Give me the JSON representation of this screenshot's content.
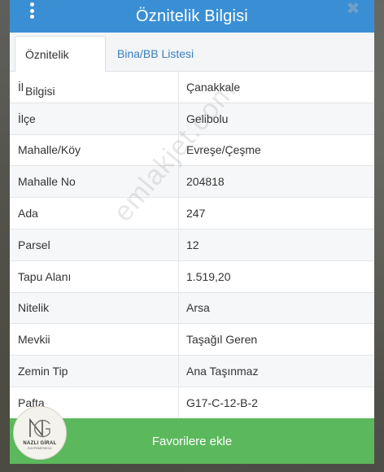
{
  "dialog": {
    "title": "Öznitelik Bilgisi",
    "close_symbol": "✖"
  },
  "tabs": [
    {
      "label": "Öznitelik Bilgisi",
      "active": true
    },
    {
      "label": "Bina/BB Listesi",
      "active": false
    }
  ],
  "rows": [
    {
      "label": "İl",
      "value": "Çanakkale"
    },
    {
      "label": "İlçe",
      "value": "Gelibolu"
    },
    {
      "label": "Mahalle/Köy",
      "value": "Evreşe/Çeşme"
    },
    {
      "label": "Mahalle No",
      "value": "204818"
    },
    {
      "label": "Ada",
      "value": "247"
    },
    {
      "label": "Parsel",
      "value": "12"
    },
    {
      "label": "Tapu Alanı",
      "value": "1.519,20"
    },
    {
      "label": "Nitelik",
      "value": "Arsa"
    },
    {
      "label": "Mevkii",
      "value": "Taşağıl Geren"
    },
    {
      "label": "Zemin Tip",
      "value": "Ana Taşınmaz"
    },
    {
      "label": "Pafta",
      "value": "G17-C-12-B-2"
    }
  ],
  "watermark": "emlakjet.com",
  "favorite_button": "Favorilere ekle",
  "logo": {
    "name": "NAZLI GİRAL",
    "subtitle": "GAYRİMENKUL"
  },
  "colors": {
    "header": "#3a8fd4",
    "tab_link": "#3a7fbf",
    "favorite_button": "#5cb85c"
  }
}
